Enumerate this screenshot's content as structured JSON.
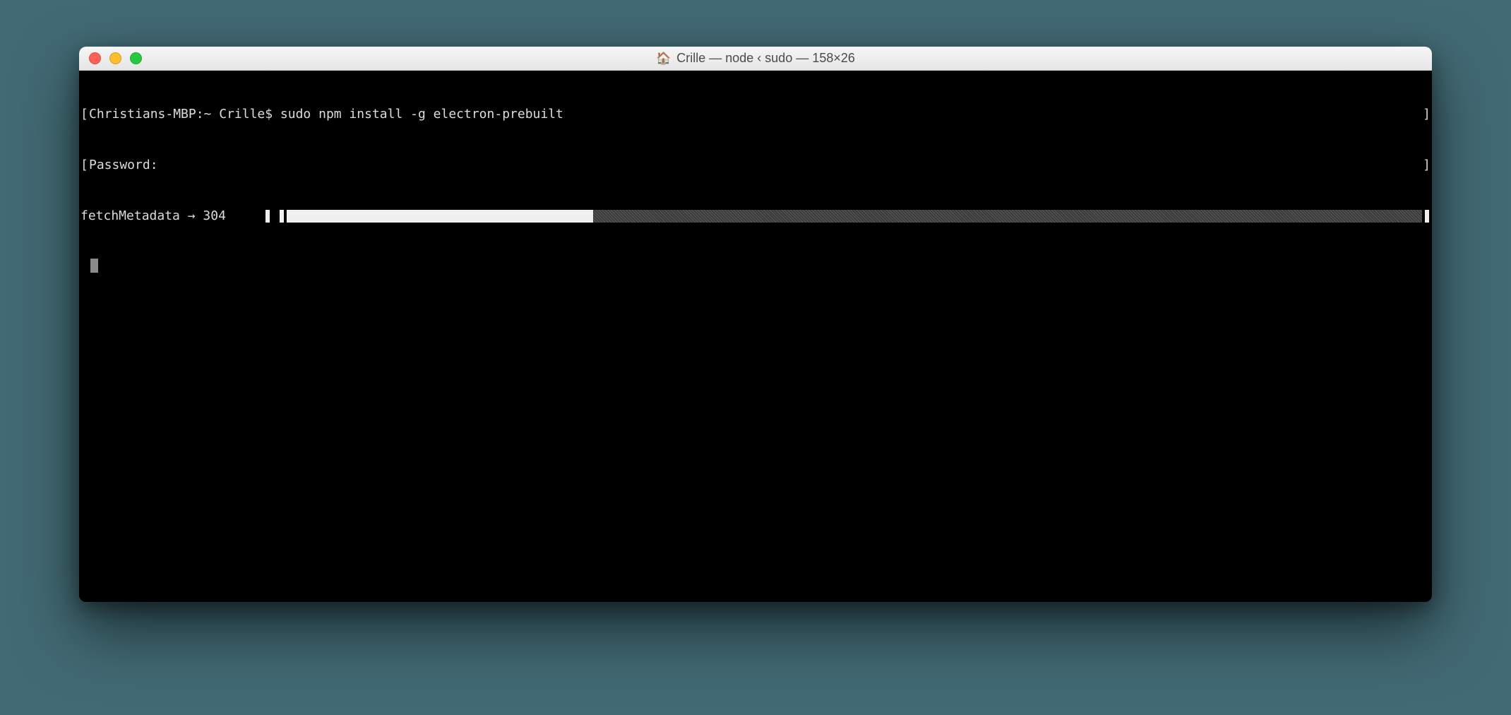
{
  "window": {
    "title": "Crille — node ‹ sudo — 158×26"
  },
  "terminal": {
    "line1": "Christians-MBP:~ Crille$ sudo npm install -g electron-prebuilt",
    "line2": "Password:",
    "progress": {
      "label": "fetchMetadata → 304     ",
      "fill_percent": 27
    }
  }
}
